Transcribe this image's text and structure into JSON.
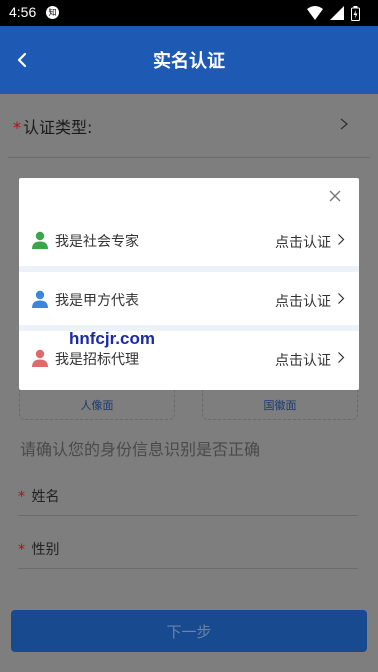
{
  "status_bar": {
    "time": "4:56",
    "notification_badge": "知",
    "icons": [
      "wifi-icon",
      "signal-icon",
      "battery-icon"
    ]
  },
  "app_bar": {
    "title": "实名认证"
  },
  "form": {
    "required_mark": "*",
    "type_label": "认证类型:",
    "upload_front_label": "人像面",
    "upload_back_label": "国徽面",
    "confirm_text": "请确认您的身份信息识别是否正确",
    "name_label": "姓名",
    "gender_label": "性别",
    "next_label": "下一步"
  },
  "modal": {
    "options": [
      {
        "label": "我是社会专家",
        "action": "点击认证",
        "icon_color": "#3aa54a"
      },
      {
        "label": "我是甲方代表",
        "action": "点击认证",
        "icon_color": "#3c86db"
      },
      {
        "label": "我是招标代理",
        "action": "点击认证",
        "icon_color": "#e06a6a"
      }
    ]
  },
  "watermark": "hnfcjr.com"
}
